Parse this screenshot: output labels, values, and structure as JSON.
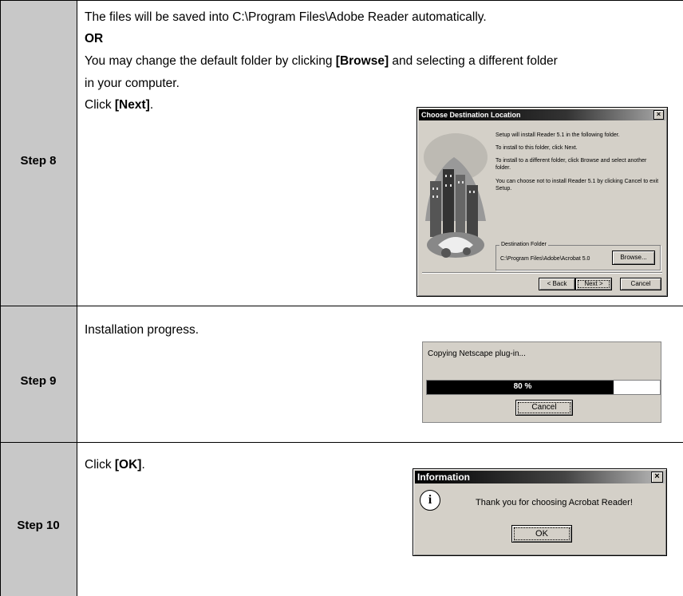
{
  "steps": [
    {
      "label": "Step 8",
      "lines": {
        "l1": "The files will be saved into C:\\Program Files\\Adobe Reader automatically.",
        "l2": "OR",
        "l3_pre": "You may change the default folder by clicking ",
        "l3_bold": "[Browse]",
        "l3_post": " and selecting a different folder",
        "l4": "in your computer.",
        "l5_pre": "Click ",
        "l5_bold": "[Next]",
        "l5_post": "."
      },
      "dialog": {
        "title": "Choose Destination Location",
        "close": "×",
        "p1": "Setup will install Reader 5.1 in the following folder.",
        "p2": "To install to this folder, click Next.",
        "p3": "To install to a different folder, click Browse and select another folder.",
        "p4": "You can choose not to install Reader 5.1 by clicking Cancel to exit Setup.",
        "group_label": "Destination Folder",
        "folder": "C:\\Program Files\\Adobe\\Acrobat 5.0",
        "browse": "Browse...",
        "back": "< Back",
        "next": "Next >",
        "cancel": "Cancel"
      }
    },
    {
      "label": "Step 9",
      "lines": {
        "l1": "Installation progress."
      },
      "dialog": {
        "message": "Copying Netscape plug-in...",
        "progress_percent": 80,
        "progress_text": "80 %",
        "cancel": "Cancel"
      }
    },
    {
      "label": "Step 10",
      "lines": {
        "l1_pre": "Click ",
        "l1_bold": "[OK]",
        "l1_post": "."
      },
      "dialog": {
        "title": "Information",
        "close": "×",
        "info_glyph": "i",
        "message": "Thank you for choosing Acrobat Reader!",
        "ok": "OK"
      }
    }
  ]
}
